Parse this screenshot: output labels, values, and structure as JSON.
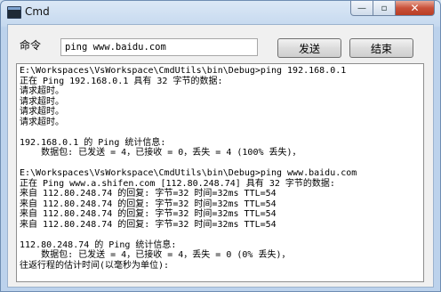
{
  "window": {
    "title": "Cmd",
    "minimize_label": "—",
    "maximize_label": "▫",
    "close_label": "✕",
    "close_color": "#c9513a"
  },
  "command": {
    "label": "命令",
    "value": "ping www.baidu.com"
  },
  "buttons": {
    "send_label": "发送",
    "end_label": "结束"
  },
  "output": {
    "lines": [
      "E:\\Workspaces\\VsWorkspace\\CmdUtils\\bin\\Debug>ping 192.168.0.1",
      "正在 Ping 192.168.0.1 具有 32 字节的数据:",
      "请求超时。",
      "请求超时。",
      "请求超时。",
      "请求超时。",
      "",
      "192.168.0.1 的 Ping 统计信息:",
      "    数据包: 已发送 = 4，已接收 = 0，丢失 = 4 (100% 丢失)，",
      "",
      "E:\\Workspaces\\VsWorkspace\\CmdUtils\\bin\\Debug>ping www.baidu.com",
      "正在 Ping www.a.shifen.com [112.80.248.74] 具有 32 字节的数据:",
      "来自 112.80.248.74 的回复: 字节=32 时间=32ms TTL=54",
      "来自 112.80.248.74 的回复: 字节=32 时间=32ms TTL=54",
      "来自 112.80.248.74 的回复: 字节=32 时间=32ms TTL=54",
      "来自 112.80.248.74 的回复: 字节=32 时间=32ms TTL=54",
      "",
      "112.80.248.74 的 Ping 统计信息:",
      "    数据包: 已发送 = 4，已接收 = 4，丢失 = 0 (0% 丢失)，",
      "往返行程的估计时间(以毫秒为单位):"
    ]
  }
}
